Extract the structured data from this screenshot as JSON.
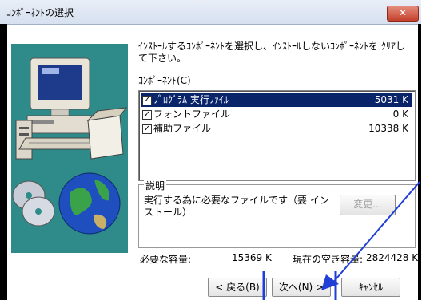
{
  "window": {
    "title": "ｺﾝﾎﾟｰﾈﾝﾄの選択",
    "close_label": "✕"
  },
  "prompt": "ｲﾝｽﾄｰﾙするｺﾝﾎﾟｰﾈﾝﾄを選択し、ｲﾝｽﾄｰﾙしないｺﾝﾎﾟｰﾈﾝﾄを ｸﾘｱして下さい。",
  "components_label": "ｺﾝﾎﾟｰﾈﾝﾄ(C)",
  "components": [
    {
      "name": "ﾌﾟﾛｸﾞﾗﾑ 実行ﾌｧｲﾙ",
      "size": "5031 K",
      "checked": true,
      "selected": true
    },
    {
      "name": "フォントファイル",
      "size": "0 K",
      "checked": true,
      "selected": false
    },
    {
      "name": "補助ファイル",
      "size": "10338 K",
      "checked": true,
      "selected": false
    }
  ],
  "description": {
    "group_label": "説明",
    "text": "実行する為に必要なファイルです（要 インストール）",
    "change_button": "変更..."
  },
  "space": {
    "required_label": "必要な容量:",
    "required_value": "15369 K",
    "free_label": "現在の空き容量:",
    "free_value": "2824428 K"
  },
  "buttons": {
    "back": "< 戻る(B)",
    "next": "次へ(N) >",
    "cancel": "ｷｬﾝｾﾙ"
  },
  "colors": {
    "selection": "#0a246a",
    "annotation": "#1f3fd6",
    "art_bg": "#2f8a8a"
  }
}
